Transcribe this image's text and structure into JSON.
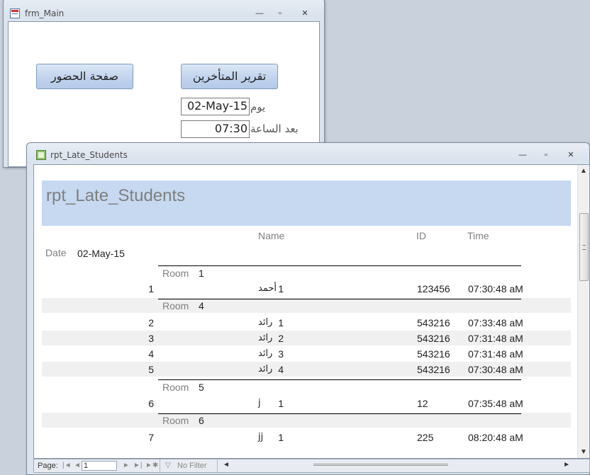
{
  "frm_main": {
    "title": "frm_Main",
    "controls": {
      "minimize": "—",
      "restore": "▫",
      "close": "✕"
    },
    "attendance_button": "صفحة الحضور",
    "late_report_button": "تقرير المتأخرين",
    "date_label": "يوم",
    "date_value": "02-May-15",
    "time_label": "بعد الساعة",
    "time_value": "07:30"
  },
  "report_window": {
    "title": "rpt_Late_Students",
    "controls": {
      "minimize": "—",
      "restore": "▫",
      "close": "✕"
    }
  },
  "report": {
    "title": "rpt_Late_Students",
    "columns": {
      "name": "Name",
      "id": "ID",
      "time": "Time"
    },
    "date_label": "Date",
    "date_value": "02-May-15",
    "group_label": "Room",
    "groups": [
      {
        "room": "1",
        "rows": [
          {
            "rec": "1",
            "no": "1",
            "name": "أحمد",
            "id": "123456",
            "time": "07:30:48 aM"
          }
        ]
      },
      {
        "room": "4",
        "rows": [
          {
            "rec": "2",
            "no": "1",
            "name": "رائد",
            "id": "543216",
            "time": "07:33:48 aM"
          },
          {
            "rec": "3",
            "no": "2",
            "name": "رائد",
            "id": "543216",
            "time": "07:31:48 aM"
          },
          {
            "rec": "4",
            "no": "3",
            "name": "رائد",
            "id": "543216",
            "time": "07:31:48 aM"
          },
          {
            "rec": "5",
            "no": "4",
            "name": "رائد",
            "id": "543216",
            "time": "07:30:48 aM"
          }
        ]
      },
      {
        "room": "5",
        "rows": [
          {
            "rec": "6",
            "no": "1",
            "name": "j",
            "id": "12",
            "time": "07:35:48 aM"
          }
        ]
      },
      {
        "room": "6",
        "rows": [
          {
            "rec": "7",
            "no": "1",
            "name": "jj",
            "id": "225",
            "time": "08:20:48 aM"
          }
        ]
      }
    ]
  },
  "status_bar": {
    "page_label": "Page:",
    "page_value": "1",
    "filter_label": "No Filter"
  }
}
